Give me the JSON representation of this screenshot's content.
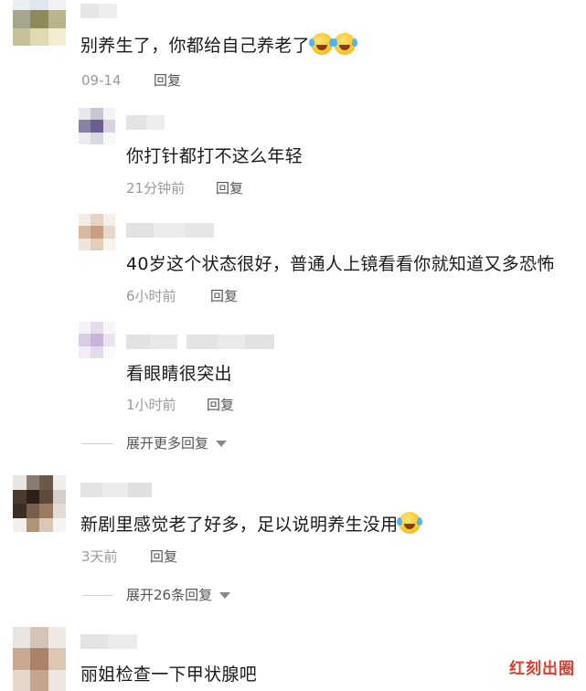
{
  "comments": [
    {
      "text": "别养生了，你都给自己养老了",
      "emoji": [
        "laugh-cry-emoji",
        "laugh-cry-emoji"
      ],
      "time": "09-14",
      "reply_label": "回复",
      "replies": [
        {
          "text": "你打针都打不这么年轻",
          "time": "21分钟前",
          "reply_label": "回复"
        },
        {
          "text": "40岁这个状态很好，普通人上镜看看你就知道又多恐怖",
          "time": "6小时前",
          "reply_label": "回复"
        },
        {
          "text": "看眼睛很突出",
          "time": "1小时前",
          "reply_label": "回复"
        }
      ],
      "expand_label": "展开更多回复"
    },
    {
      "text": "新剧里感觉老了好多，足以说明养生没用",
      "emoji": [
        "laugh-cry-emoji"
      ],
      "time": "3天前",
      "reply_label": "回复",
      "expand_label": "展开26条回复"
    },
    {
      "text": "丽姐检查一下甲状腺吧"
    }
  ],
  "watermark": "红刻出圈",
  "colors": {
    "meta": "#9a9a9a",
    "reply": "#555555",
    "watermark": "#e23a2a"
  }
}
